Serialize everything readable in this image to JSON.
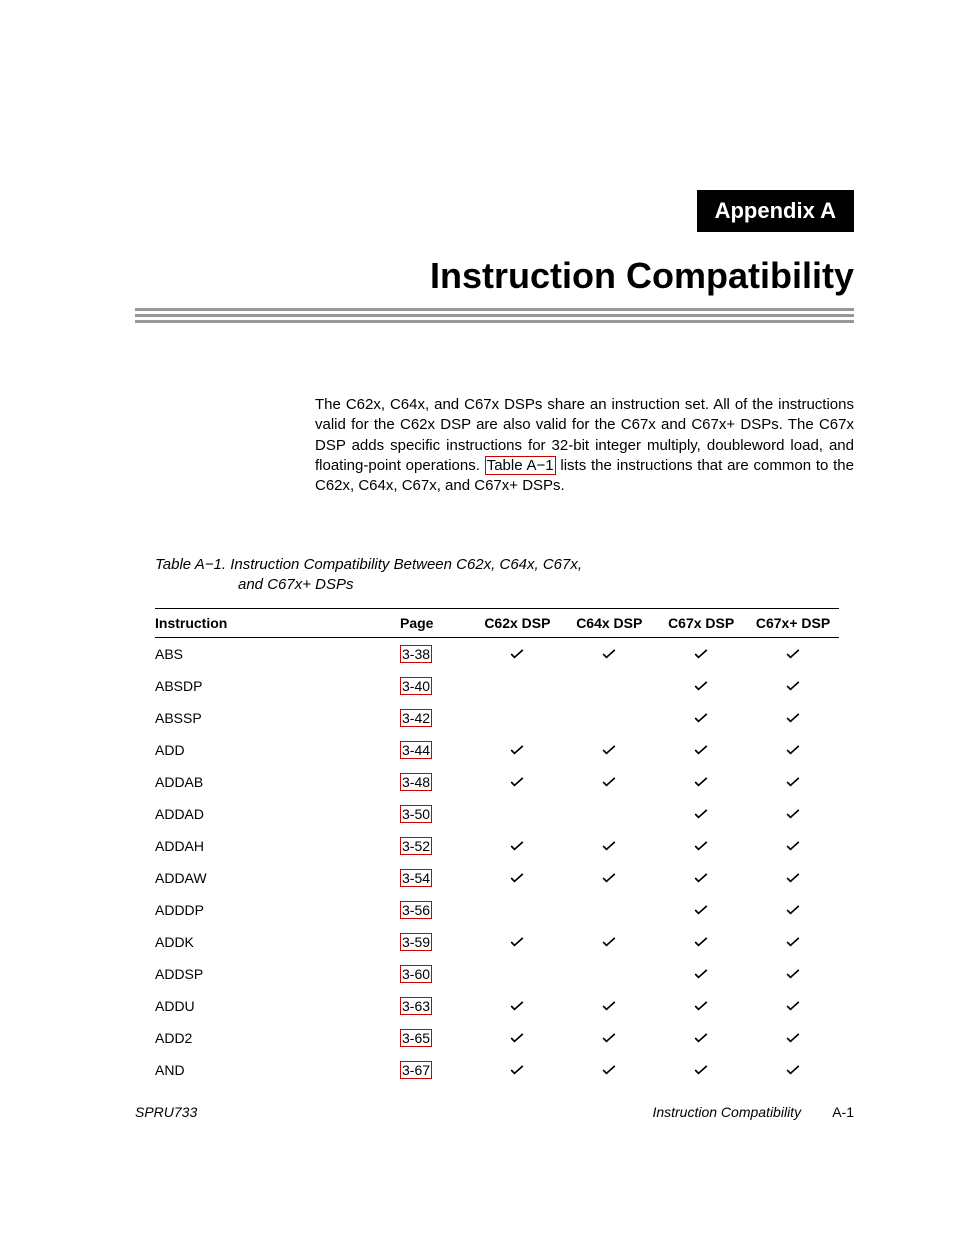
{
  "appendix": "Appendix A",
  "title": "Instruction Compatibility",
  "intro_pre": "The C62x, C64x, and C67x DSPs share an instruction set. All of the instructions valid for the C62x DSP are also valid for the C67x and C67x+ DSPs. The C67x DSP adds specific instructions for 32-bit integer multiply, doubleword load, and floating-point operations. ",
  "intro_link": "Table A−1",
  "intro_post": " lists the instructions that are common to the C62x, C64x, C67x, and C67x+ DSPs.",
  "table_caption_lead": "Table A−1. Instruction Compatibility Between C62x, C64x, C67x,",
  "table_caption_cont": "and C67x+ DSPs",
  "columns": {
    "instruction": "Instruction",
    "page": "Page",
    "c62": "C62x DSP",
    "c64": "C64x DSP",
    "c67": "C67x DSP",
    "c67p": "C67x+ DSP"
  },
  "rows": [
    {
      "instr": "ABS",
      "page": "3-38",
      "c62": true,
      "c64": true,
      "c67": true,
      "c67p": true
    },
    {
      "instr": "ABSDP",
      "page": "3-40",
      "c62": false,
      "c64": false,
      "c67": true,
      "c67p": true
    },
    {
      "instr": "ABSSP",
      "page": "3-42",
      "c62": false,
      "c64": false,
      "c67": true,
      "c67p": true
    },
    {
      "instr": "ADD",
      "page": "3-44",
      "c62": true,
      "c64": true,
      "c67": true,
      "c67p": true
    },
    {
      "instr": "ADDAB",
      "page": "3-48",
      "c62": true,
      "c64": true,
      "c67": true,
      "c67p": true
    },
    {
      "instr": "ADDAD",
      "page": "3-50",
      "c62": false,
      "c64": false,
      "c67": true,
      "c67p": true
    },
    {
      "instr": "ADDAH",
      "page": "3-52",
      "c62": true,
      "c64": true,
      "c67": true,
      "c67p": true
    },
    {
      "instr": "ADDAW",
      "page": "3-54",
      "c62": true,
      "c64": true,
      "c67": true,
      "c67p": true
    },
    {
      "instr": "ADDDP",
      "page": "3-56",
      "c62": false,
      "c64": false,
      "c67": true,
      "c67p": true
    },
    {
      "instr": "ADDK",
      "page": "3-59",
      "c62": true,
      "c64": true,
      "c67": true,
      "c67p": true
    },
    {
      "instr": "ADDSP",
      "page": "3-60",
      "c62": false,
      "c64": false,
      "c67": true,
      "c67p": true
    },
    {
      "instr": "ADDU",
      "page": "3-63",
      "c62": true,
      "c64": true,
      "c67": true,
      "c67p": true
    },
    {
      "instr": "ADD2",
      "page": "3-65",
      "c62": true,
      "c64": true,
      "c67": true,
      "c67p": true
    },
    {
      "instr": "AND",
      "page": "3-67",
      "c62": true,
      "c64": true,
      "c67": true,
      "c67p": true
    }
  ],
  "footer": {
    "doc_id": "SPRU733",
    "section": "Instruction Compatibility",
    "page_no": "A-1"
  }
}
